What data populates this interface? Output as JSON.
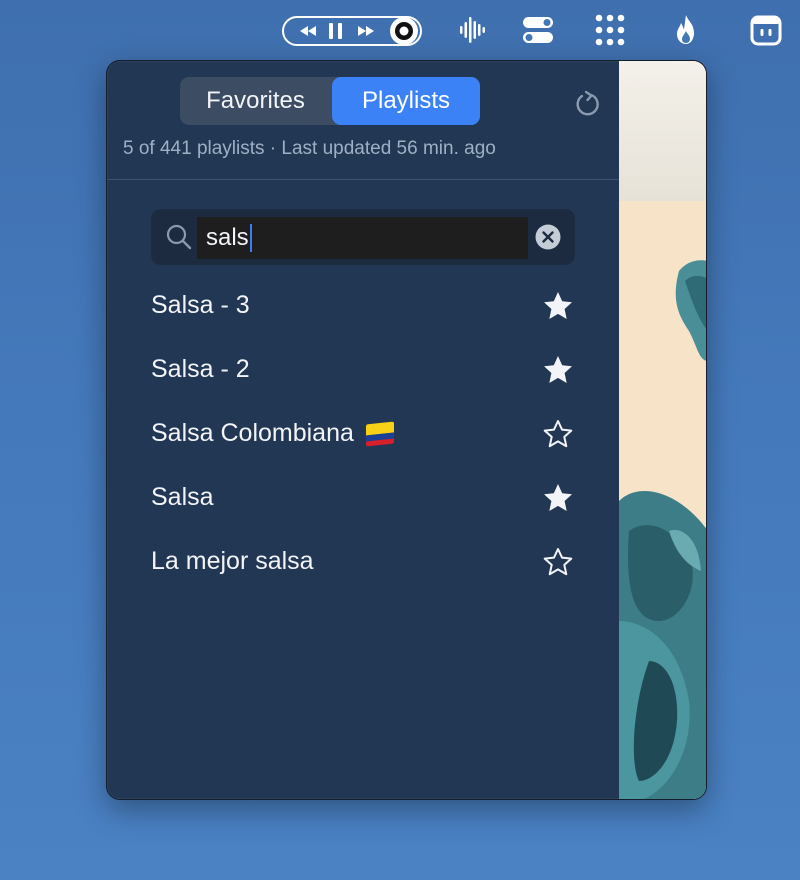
{
  "menubar": {
    "icons": [
      "rewind-icon",
      "pause-icon",
      "fast-forward-icon",
      "record-dot-icon",
      "waveform-icon",
      "toggle-switches-icon",
      "dots-grid-icon",
      "flame-icon",
      "robot-face-icon"
    ]
  },
  "popover": {
    "tabs": [
      {
        "label": "Favorites",
        "selected": false
      },
      {
        "label": "Playlists",
        "selected": true
      }
    ],
    "status": "5 of 441 playlists · Last updated 56 min. ago",
    "search": {
      "value": "sals",
      "placeholder": ""
    },
    "playlists": [
      {
        "name": "Salsa - 3",
        "favorite": true,
        "flag": false
      },
      {
        "name": "Salsa - 2",
        "favorite": true,
        "flag": false
      },
      {
        "name": "Salsa Colombiana",
        "favorite": false,
        "flag": true
      },
      {
        "name": "Salsa",
        "favorite": true,
        "flag": false
      },
      {
        "name": "La mejor salsa",
        "favorite": false,
        "flag": false
      }
    ],
    "colors": {
      "accent": "#3b82f7",
      "panel": "#223753",
      "text": "#f2f4f8"
    }
  }
}
